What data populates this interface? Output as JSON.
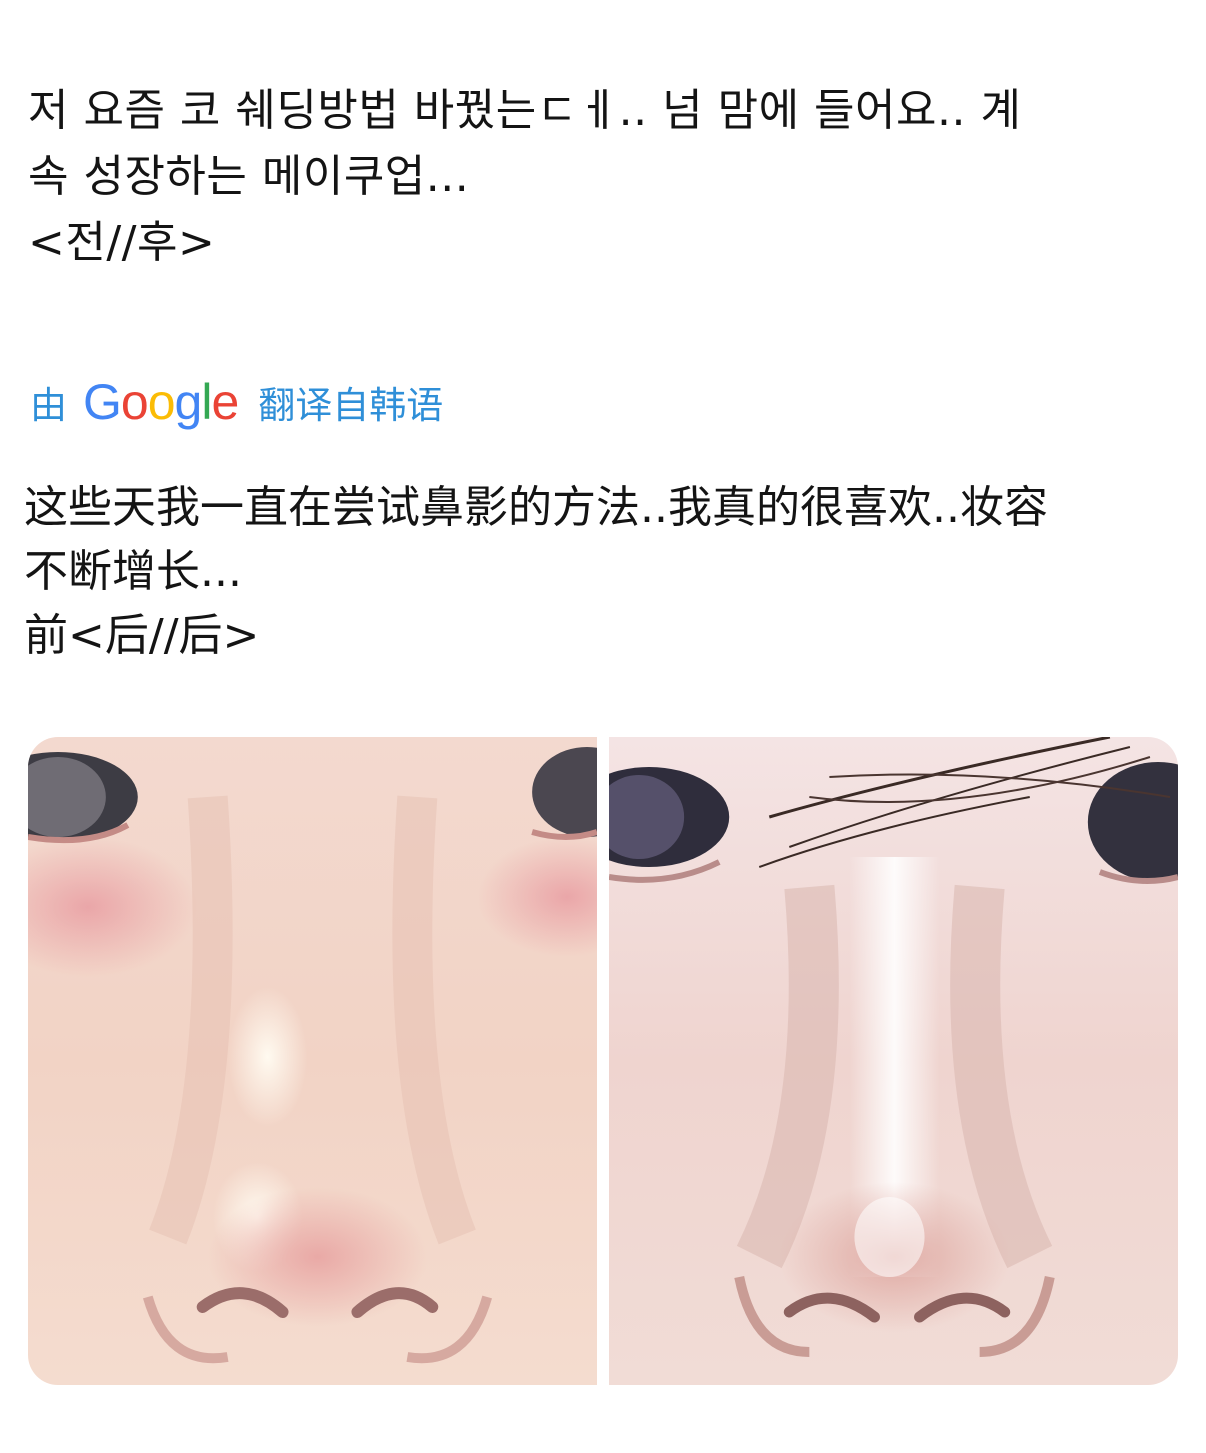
{
  "tweet": {
    "text": "저 요즘 코 쉐딩방법 바꿨는ㄷㅔ.. 넘 맘에 들어요.. 계\n속 성장하는 메이쿠업...\n<전//후>"
  },
  "translation": {
    "prefix": "由",
    "provider": "Google",
    "suffix": "翻译自韩语",
    "text": "这些天我一直在尝试鼻影的方法..我真的很喜欢..妆容\n不断增长...\n前<后//后>",
    "colors": {
      "link": "#2f8fd8",
      "google_blue": "#4285F4",
      "google_red": "#EA4335",
      "google_yellow": "#FBBC05",
      "google_green": "#34A853"
    }
  },
  "media": {
    "images": [
      {
        "name": "before-nose-photo"
      },
      {
        "name": "after-nose-photo"
      }
    ]
  }
}
